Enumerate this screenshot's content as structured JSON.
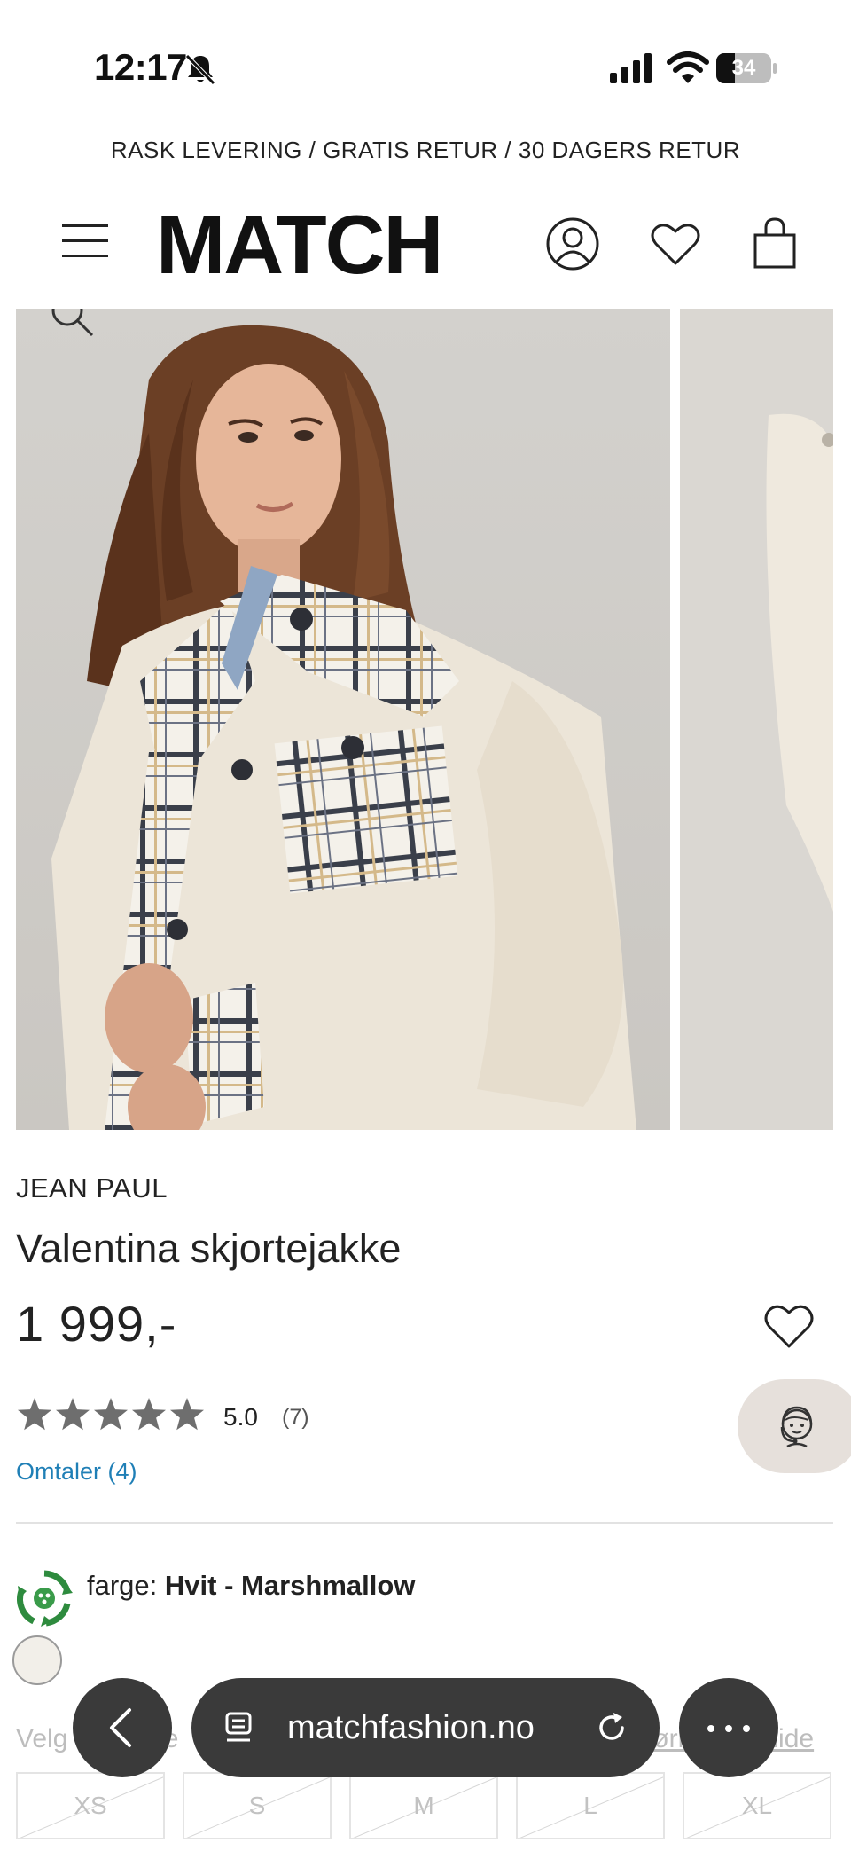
{
  "status_bar": {
    "time": "12:17",
    "battery": "34",
    "battery_level": 0.34,
    "icons": [
      "bell-muted-icon",
      "cellular-signal-icon",
      "wifi-icon",
      "battery-icon"
    ]
  },
  "promo": {
    "text": "RASK LEVERING / GRATIS RETUR / 30 DAGERS RETUR"
  },
  "header": {
    "logo": "MATCH",
    "icons": [
      "menu-icon",
      "account-icon",
      "heart-icon",
      "bag-icon"
    ]
  },
  "product": {
    "brand": "JEAN PAUL",
    "name": "Valentina skjortejakke",
    "price": "1 999,-",
    "rating": {
      "value": "5.0",
      "count": "(7)",
      "stars": 5,
      "max_stars": 5
    },
    "reviews_link": "Omtaler (4)",
    "color": {
      "label": "farge:",
      "value": "Hvit - Marshmallow",
      "swatch_hex": "#f2efe9"
    },
    "size": {
      "label": "Velg størrelse",
      "guide": "Størrelsesguide",
      "options": [
        "XS",
        "S",
        "M",
        "L",
        "XL"
      ]
    }
  },
  "browser": {
    "url": "matchfashion.no",
    "icons": [
      "back-icon",
      "page-icon",
      "reload-icon",
      "more-icon"
    ]
  },
  "colors": {
    "accent_link": "#1f7fb6",
    "support_bg": "#e6e0db",
    "browser_bar": "#3a3a3a",
    "eco_green": "#2e8b3e"
  }
}
